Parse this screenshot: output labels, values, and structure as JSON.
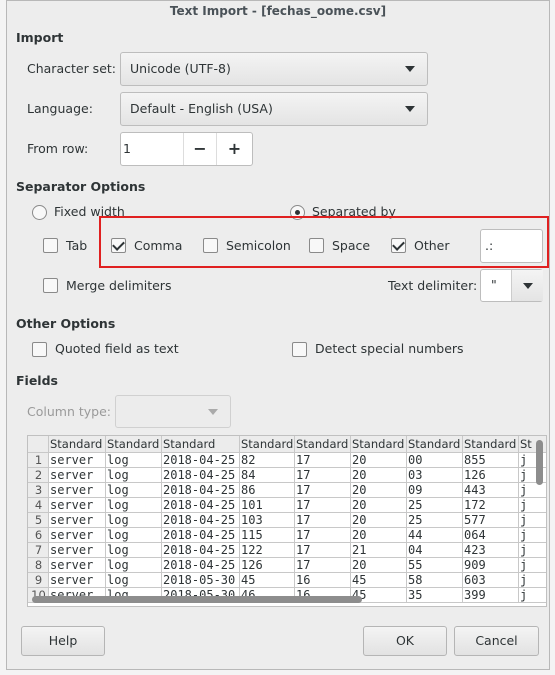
{
  "window": {
    "title": "Text Import - [fechas_oome.csv]"
  },
  "import": {
    "header": "Import",
    "charset_label": "Character set:",
    "charset_value": "Unicode (UTF-8)",
    "language_label": "Language:",
    "language_value": "Default - English (USA)",
    "from_row_label": "From row:",
    "from_row_value": "1",
    "minus": "−",
    "plus": "+"
  },
  "separator": {
    "header": "Separator Options",
    "fixed_width": "Fixed width",
    "separated_by": "Separated by",
    "fixed_selected": false,
    "separated_selected": true,
    "tab": {
      "label": "Tab",
      "checked": false
    },
    "comma": {
      "label": "Comma",
      "checked": true
    },
    "semicolon": {
      "label": "Semicolon",
      "checked": false
    },
    "space": {
      "label": "Space",
      "checked": false
    },
    "other": {
      "label": "Other",
      "checked": true,
      "value": ".:"
    },
    "merge": {
      "label": "Merge delimiters",
      "checked": false
    },
    "text_delimiter_label": "Text delimiter:",
    "text_delimiter_value": "\"",
    "highlight_color": "#e02020"
  },
  "other_options": {
    "header": "Other Options",
    "quoted": {
      "label": "Quoted field as text",
      "checked": false
    },
    "detect": {
      "label": "Detect special numbers",
      "checked": false
    }
  },
  "fields": {
    "header": "Fields",
    "column_type_label": "Column type:",
    "column_type_value": "",
    "columns": [
      "Standard",
      "Standard",
      "Standard",
      "Standard",
      "Standard",
      "Standard",
      "Standard",
      "Standard",
      "St"
    ],
    "rows": [
      [
        "1",
        "server",
        "log",
        "2018-04-25",
        "82",
        "17",
        "20",
        "00",
        "855",
        "j"
      ],
      [
        "2",
        "server",
        "log",
        "2018-04-25",
        "84",
        "17",
        "20",
        "03",
        "126",
        "j"
      ],
      [
        "3",
        "server",
        "log",
        "2018-04-25",
        "86",
        "17",
        "20",
        "09",
        "443",
        "j"
      ],
      [
        "4",
        "server",
        "log",
        "2018-04-25",
        "101",
        "17",
        "20",
        "25",
        "172",
        "j"
      ],
      [
        "5",
        "server",
        "log",
        "2018-04-25",
        "103",
        "17",
        "20",
        "25",
        "577",
        "j"
      ],
      [
        "6",
        "server",
        "log",
        "2018-04-25",
        "115",
        "17",
        "20",
        "44",
        "064",
        "j"
      ],
      [
        "7",
        "server",
        "log",
        "2018-04-25",
        "122",
        "17",
        "21",
        "04",
        "423",
        "j"
      ],
      [
        "8",
        "server",
        "log",
        "2018-04-25",
        "126",
        "17",
        "20",
        "55",
        "909",
        "j"
      ],
      [
        "9",
        "server",
        "log",
        "2018-05-30",
        "45",
        "16",
        "45",
        "58",
        "603",
        "j"
      ],
      [
        "10",
        "server",
        "log",
        "2018-05-30",
        "46",
        "16",
        "45",
        "35",
        "399",
        "j"
      ]
    ]
  },
  "buttons": {
    "help": "Help",
    "ok": "OK",
    "cancel": "Cancel"
  }
}
